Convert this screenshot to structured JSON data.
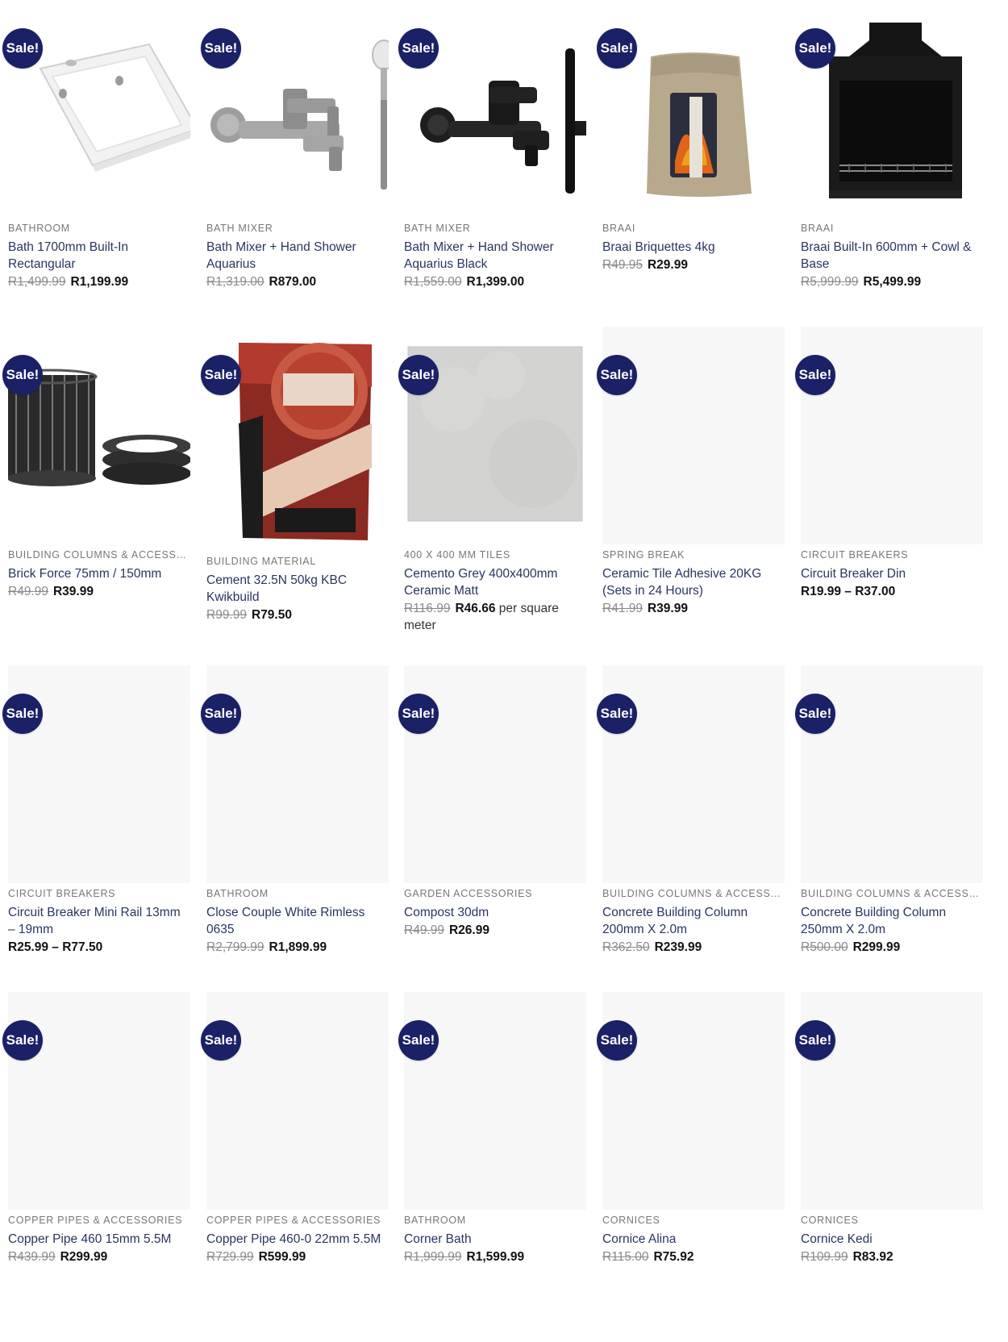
{
  "sale_label": "Sale!",
  "colors": {
    "badge": "#1b2166",
    "title": "#2a3560",
    "placeholder": "#f7f7f7"
  },
  "products": [
    {
      "category": "BATHROOM",
      "title": "Bath 1700mm Built-In Rectangular",
      "old_price": "R1,499.99",
      "price": "R1,199.99",
      "image": "bath-tub-image"
    },
    {
      "category": "BATH MIXER",
      "title": "Bath Mixer + Hand Shower Aquarius",
      "old_price": "R1,319.00",
      "price": "R879.00",
      "image": "chrome-bath-mixer-image"
    },
    {
      "category": "BATH MIXER",
      "title": "Bath Mixer + Hand Shower Aquarius Black",
      "old_price": "R1,559.00",
      "price": "R1,399.00",
      "image": "black-bath-mixer-image"
    },
    {
      "category": "BRAAI",
      "title": "Braai Briquettes 4kg",
      "old_price": "R49.95",
      "price": "R29.99",
      "image": "briquettes-bag-image"
    },
    {
      "category": "BRAAI",
      "title": "Braai Built-In 600mm + Cowl & Base",
      "old_price": "R5,999.99",
      "price": "R5,499.99",
      "image": "built-in-braai-image"
    },
    {
      "category": "BUILDING COLUMNS & ACCESSORIES",
      "title": "Brick Force 75mm / 150mm",
      "old_price": "R49.99",
      "price": "R39.99",
      "image": "brick-force-coils-image"
    },
    {
      "category": "BUILDING MATERIAL",
      "title": "Cement 32.5N 50kg KBC Kwikbuild",
      "old_price": "R99.99",
      "price": "R79.50",
      "image": "cement-bag-image"
    },
    {
      "category": "400 X 400 MM TILES",
      "title": "Cemento Grey 400x400mm Ceramic Matt",
      "old_price": "R116.99",
      "price": "R46.66",
      "unit": "per square meter",
      "image": "grey-tile-image"
    },
    {
      "category": "SPRING BREAK",
      "title": "Ceramic Tile Adhesive 20KG (Sets in 24 Hours)",
      "old_price": "R41.99",
      "price": "R39.99"
    },
    {
      "category": "CIRCUIT BREAKERS",
      "title": "Circuit Breaker Din",
      "price": "R19.99 – R37.00"
    },
    {
      "category": "CIRCUIT BREAKERS",
      "title": "Circuit Breaker Mini Rail 13mm – 19mm",
      "price": "R25.99 – R77.50"
    },
    {
      "category": "BATHROOM",
      "title": "Close Couple White Rimless 0635",
      "old_price": "R2,799.99",
      "price": "R1,899.99"
    },
    {
      "category": "GARDEN ACCESSORIES",
      "title": "Compost 30dm",
      "old_price": "R49.99",
      "price": "R26.99"
    },
    {
      "category": "BUILDING COLUMNS & ACCESSORIES",
      "title": "Concrete Building Column 200mm X 2.0m",
      "old_price": "R362.50",
      "price": "R239.99"
    },
    {
      "category": "BUILDING COLUMNS & ACCESSORIES",
      "title": "Concrete Building Column 250mm X 2.0m",
      "old_price": "R500.00",
      "price": "R299.99"
    },
    {
      "category": "COPPER PIPES & ACCESSORIES",
      "title": "Copper Pipe 460 15mm 5.5M",
      "old_price": "R439.99",
      "price": "R299.99"
    },
    {
      "category": "COPPER PIPES & ACCESSORIES",
      "title": "Copper Pipe 460-0 22mm 5.5M",
      "old_price": "R729.99",
      "price": "R599.99"
    },
    {
      "category": "BATHROOM",
      "title": "Corner Bath",
      "old_price": "R1,999.99",
      "price": "R1,599.99"
    },
    {
      "category": "CORNICES",
      "title": "Cornice Alina",
      "old_price": "R115.00",
      "price": "R75.92"
    },
    {
      "category": "CORNICES",
      "title": "Cornice Kedi",
      "old_price": "R109.99",
      "price": "R83.92"
    }
  ]
}
